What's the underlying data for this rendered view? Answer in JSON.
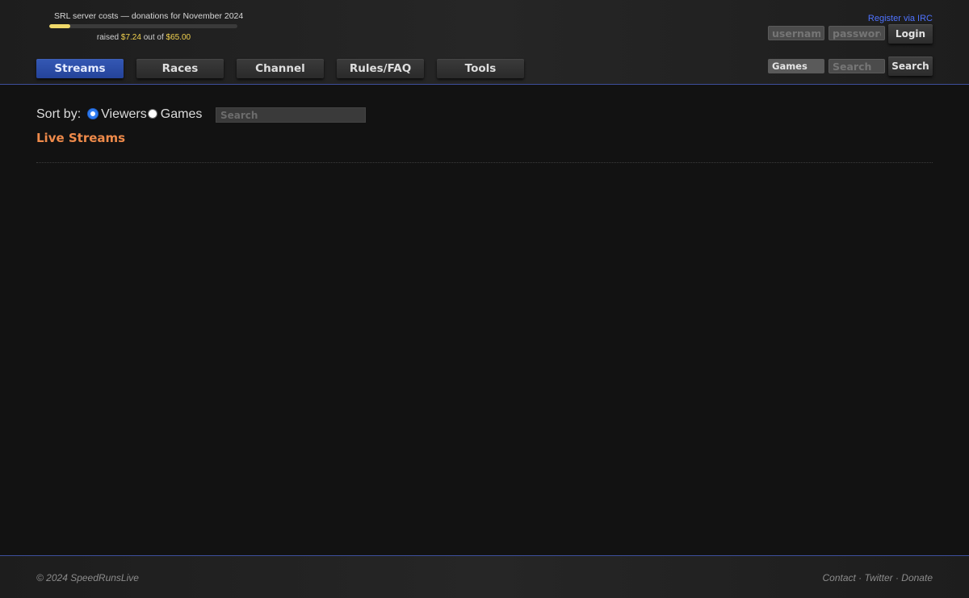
{
  "donation": {
    "title": "SRL server costs — donations for November 2024",
    "raised_prefix": "raised",
    "raised_amount": "$7.24",
    "raised_mid": "out of",
    "goal_amount": "$65.00",
    "progress_fraction": 0.11
  },
  "nav": {
    "tabs": [
      {
        "label": "Streams",
        "active": true
      },
      {
        "label": "Races",
        "active": false
      },
      {
        "label": "Channel",
        "active": false
      },
      {
        "label": "Rules/FAQ",
        "active": false
      },
      {
        "label": "Tools",
        "active": false
      }
    ]
  },
  "login": {
    "register_label": "Register via IRC",
    "username_placeholder": "username",
    "password_placeholder": "password",
    "login_label": "Login"
  },
  "header_search": {
    "category_selected": "Games",
    "placeholder": "Search",
    "button_label": "Search"
  },
  "main": {
    "sort_label": "Sort by:",
    "sort_options": [
      {
        "label": "Viewers",
        "checked": true
      },
      {
        "label": "Games",
        "checked": false
      }
    ],
    "search_placeholder": "Search",
    "section_title": "Live Streams"
  },
  "footer": {
    "copyright": "© 2024 SpeedRunsLive",
    "links": [
      "Contact",
      "Twitter",
      "Donate"
    ],
    "separator": " · "
  },
  "colors": {
    "accent_blue": "#2c4ea8",
    "section_orange": "#ee8a4a",
    "donation_yellow": "#f2d24f",
    "link_blue": "#4f73ff"
  }
}
